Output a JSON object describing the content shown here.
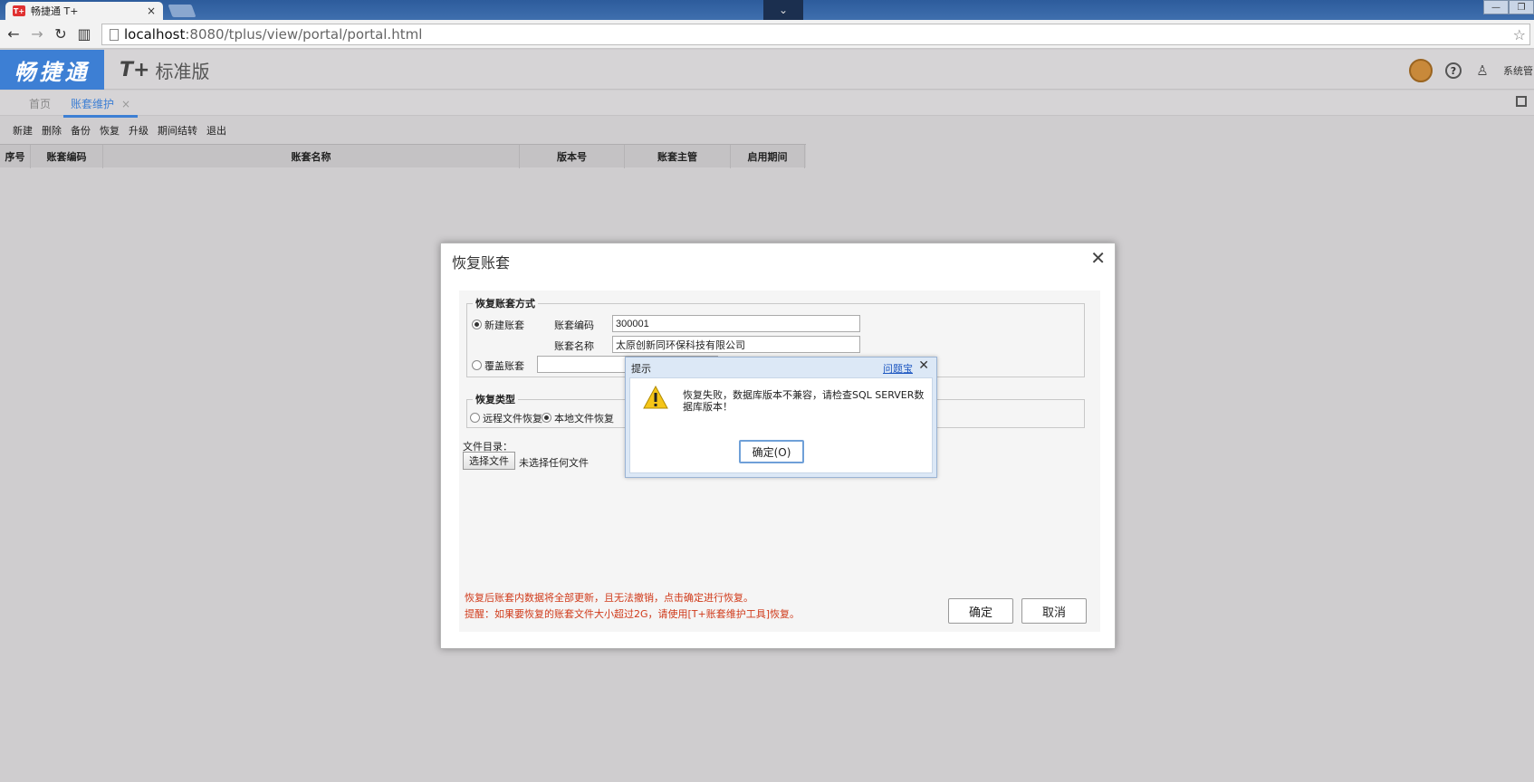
{
  "browser": {
    "tab_title": "畅捷通 T+",
    "tab_close": "×",
    "favicon_text": "T+",
    "url_host": "localhost",
    "url_path": ":8080/tplus/view/portal/portal.html"
  },
  "header": {
    "logo": "畅捷通",
    "edition_mark": "T+",
    "edition_name": "标准版",
    "help": "?",
    "user_label": "系统管"
  },
  "tabs": {
    "home": "首页",
    "active": "账套维护",
    "close": "×"
  },
  "toolbar": [
    "新建",
    "删除",
    "备份",
    "恢复",
    "升级",
    "期间结转",
    "退出"
  ],
  "grid": {
    "columns": [
      "序号",
      "账套编码",
      "账套名称",
      "版本号",
      "账套主管",
      "启用期间"
    ]
  },
  "dialog": {
    "title": "恢复账套",
    "close": "✕",
    "group1_title": "恢复账套方式",
    "option_new": "新建账套",
    "option_overwrite": "覆盖账套",
    "code_label": "账套编码",
    "code_value": "300001",
    "name_label": "账套名称",
    "name_value": "太原创新同环保科技有限公司",
    "group2_title": "恢复类型",
    "remote_restore": "远程文件恢复",
    "local_restore": "本地文件恢复",
    "file_dir_label": "文件目录：",
    "choose_file": "选择文件",
    "no_file": "未选择任何文件",
    "note1": "恢复后账套内数据将全部更新，且无法撤销，点击确定进行恢复。",
    "note2": "提醒：如果要恢复的账套文件大小超过2G，请使用[T+账套维护工具]恢复。",
    "ok": "确定",
    "cancel": "取消"
  },
  "alert": {
    "title": "提示",
    "help_link": "问题宝",
    "close": "✕",
    "message": "恢复失败，数据库版本不兼容，请检查SQL SERVER数据库版本！",
    "ok": "确定(O)"
  },
  "colors": {
    "brand_blue": "#3d7fd4",
    "warning_text": "#d03a1a",
    "background": "#cfcdcf"
  }
}
